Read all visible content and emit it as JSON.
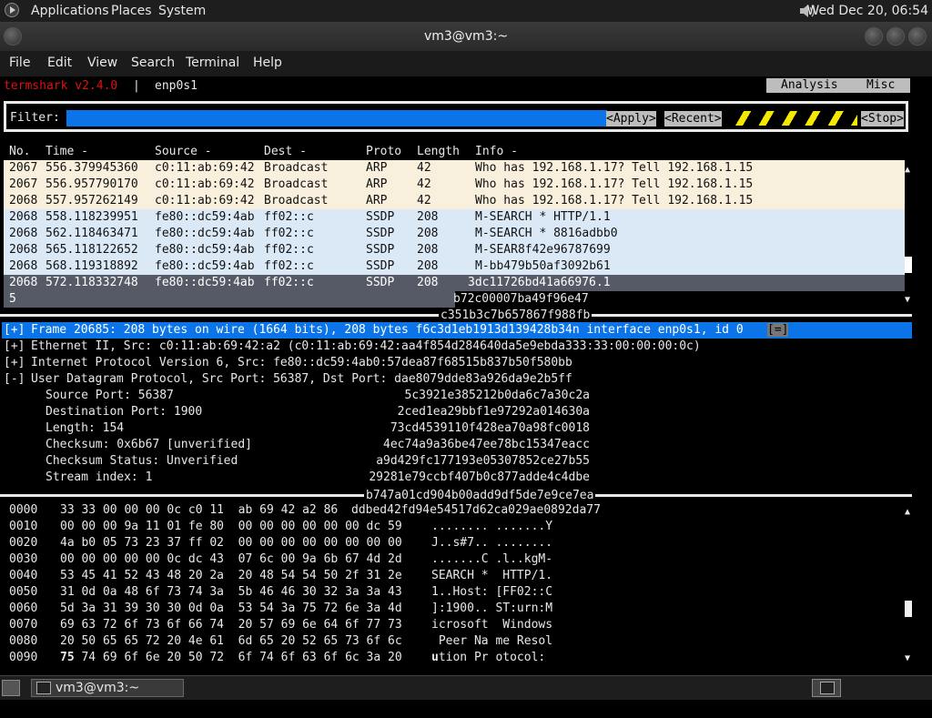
{
  "top_panel": {
    "menus": [
      "Applications",
      "Places",
      "System"
    ],
    "clock": "Wed Dec 20, 06:54"
  },
  "window": {
    "title": "vm3@vm3:~"
  },
  "menubar": [
    "File",
    "Edit",
    "View",
    "Search",
    "Terminal",
    "Help"
  ],
  "termshark": {
    "app_name": "termshark v2.4.0",
    "separator": "|",
    "interface": "enp0s1",
    "tabs": [
      "Analysis",
      "Misc"
    ],
    "filter_label": "Filter:",
    "filter_value": "",
    "apply_label": "<Apply>",
    "recent_label": "<Recent>",
    "stop_label": "<Stop>"
  },
  "packet_list": {
    "columns": [
      "No.",
      "Time -",
      "Source -",
      "Dest -",
      "Proto",
      "Length",
      "Info -"
    ],
    "rows": [
      {
        "no": "2067",
        "time": "556.379945360",
        "src": "c0:11:ab:69:42",
        "dst": "Broadcast",
        "proto": "ARP",
        "len": "42",
        "info": "Who has 192.168.1.17? Tell 192.168.1.15",
        "kind": "arp"
      },
      {
        "no": "2067",
        "time": "556.957790170",
        "src": "c0:11:ab:69:42",
        "dst": "Broadcast",
        "proto": "ARP",
        "len": "42",
        "info": "Who has 192.168.1.17? Tell 192.168.1.15",
        "kind": "arp"
      },
      {
        "no": "2068",
        "time": "557.957262149",
        "src": "c0:11:ab:69:42",
        "dst": "Broadcast",
        "proto": "ARP",
        "len": "42",
        "info": "Who has 192.168.1.17? Tell 192.168.1.15",
        "kind": "arp"
      },
      {
        "no": "2068",
        "time": "558.118239951",
        "src": "fe80::dc59:4ab",
        "dst": "ff02::c",
        "proto": "SSDP",
        "len": "208",
        "info": "M-SEARCH * HTTP/1.1",
        "kind": "ssdp"
      },
      {
        "no": "2068",
        "time": "562.118463471",
        "src": "fe80::dc59:4ab",
        "dst": "ff02::c",
        "proto": "SSDP",
        "len": "208",
        "info": "M-SEARCH * 8816adbb0",
        "kind": "ssdp"
      },
      {
        "no": "2068",
        "time": "565.118122652",
        "src": "fe80::dc59:4ab",
        "dst": "ff02::c",
        "proto": "SSDP",
        "len": "208",
        "info": "M-SEAR8f42e96787699",
        "kind": "ssdp"
      },
      {
        "no": "2068",
        "time": "568.119318892",
        "src": "fe80::dc59:4ab",
        "dst": "ff02::c",
        "proto": "SSDP",
        "len": "208",
        "info": "M-bb479b50af3092b61",
        "kind": "ssdp"
      },
      {
        "no": "2068",
        "time": "572.118332748",
        "src": "fe80::dc59:4ab",
        "dst": "ff02::c",
        "proto": "SSDP",
        "len": "208",
        "info": "3dc11726bd41a66976.1",
        "kind": "sel"
      }
    ],
    "wrap_no": "5",
    "wrap_info": "b72c00007ba49f96e47",
    "divider_text": "c351b3c7b657867f988fb"
  },
  "details": {
    "lines": [
      {
        "prefix": "[+]",
        "text": "Frame 20685: 208 bytes on wire (1664 bits), 208 bytes f6c3d1eb1913d139428b34n interface enp0s1, id 0",
        "selected": true
      },
      {
        "prefix": "[+]",
        "text": "Ethernet II, Src: c0:11:ab:69:42:a2 (c0:11:ab:69:42:aa4f854d284640da5e9ebda333:33:00:00:00:0c)"
      },
      {
        "prefix": "[+]",
        "text": "Internet Protocol Version 6, Src: fe80::dc59:4ab0:57dea87f68515b837b50f580bb"
      },
      {
        "prefix": "[-]",
        "text": "User Datagram Protocol, Src Port: 56387, Dst Port: dae8079dde83a926da9e2b5ff"
      }
    ],
    "collapse_marker": "[=]",
    "sub_lines": [
      {
        "label": "Source Port: 56387",
        "hash": "5c3921e385212b0da6c7a30c2a"
      },
      {
        "label": "Destination Port: 1900",
        "hash": "2ced1ea29bbf1e97292a014630a"
      },
      {
        "label": "Length: 154",
        "hash": "73cd4539110f428ea70a98fc0018"
      },
      {
        "label": "Checksum: 0x6b67 [unverified]",
        "hash": "4ec74a9a36be47ee78bc15347eacc"
      },
      {
        "label": "Checksum Status: Unverified",
        "hash": "a9d429fc177193e05307852ce27b55"
      },
      {
        "label": "Stream index: 1",
        "hash": "29281e79ccbf407b0c877adde4c4dbe"
      }
    ],
    "divider_text": "b747a01cd904b00add9df5de7e9ce7ea"
  },
  "hex": {
    "rows": [
      {
        "off": "0000",
        "bytes": "33 33 00 00 00 0c c0 11  ab 69 42 a2 86",
        "ascii": "ddbed42fd94e54517d62ca029ae0892da77"
      },
      {
        "off": "0010",
        "bytes": "00 00 00 9a 11 01 fe 80  00 00 00 00 00 00 dc 59",
        "ascii": "........ .......Y"
      },
      {
        "off": "0020",
        "bytes": "4a b0 05 73 23 37 ff 02  00 00 00 00 00 00 00 00",
        "ascii": "J..s#7.. ........"
      },
      {
        "off": "0030",
        "bytes": "00 00 00 00 00 0c dc 43  07 6c 00 9a 6b 67 4d 2d",
        "ascii": ".......C .l..kgM-"
      },
      {
        "off": "0040",
        "bytes": "53 45 41 52 43 48 20 2a  20 48 54 54 50 2f 31 2e",
        "ascii": "SEARCH *  HTTP/1."
      },
      {
        "off": "0050",
        "bytes": "31 0d 0a 48 6f 73 74 3a  5b 46 46 30 32 3a 3a 43",
        "ascii": "1..Host: [FF02::C"
      },
      {
        "off": "0060",
        "bytes": "5d 3a 31 39 30 30 0d 0a  53 54 3a 75 72 6e 3a 4d",
        "ascii": "]:1900.. ST:urn:M"
      },
      {
        "off": "0070",
        "bytes": "69 63 72 6f 73 6f 66 74  20 57 69 6e 64 6f 77 73",
        "ascii": "icrosoft  Windows"
      },
      {
        "off": "0080",
        "bytes": "20 50 65 65 72 20 4e 61  6d 65 20 52 65 73 6f 6c",
        "ascii": " Peer Na me Resol"
      },
      {
        "off": "0090",
        "bytes_bold": "75",
        "bytes": " 74 69 6f 6e 20 50 72  6f 74 6f 63 6f 6c 3a 20",
        "ascii_bold": "u",
        "ascii": "tion Pr otocol:"
      }
    ]
  },
  "taskbar": {
    "task_label": "vm3@vm3:~"
  },
  "colors": {
    "filter_blue": "#0a74e8",
    "arp_row": "#f8efdc",
    "ssdp_row": "#dbe9f7",
    "selected_row": "#555a66",
    "app_name_red": "#dd1111"
  },
  "icons": [
    "applications-logo-icon",
    "volume-icon",
    "terminal-icon",
    "scroll-arrow-icon"
  ]
}
